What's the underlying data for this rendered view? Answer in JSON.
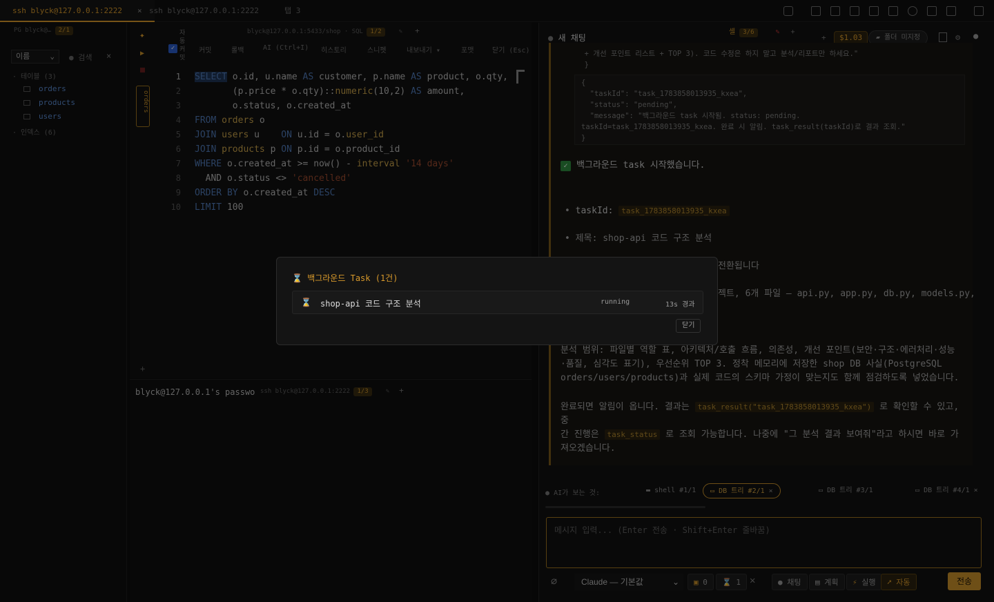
{
  "tabs": [
    {
      "label": "ssh blyck@127.0.0.1:2222",
      "close": "×"
    },
    {
      "label": "ssh blyck@127.0.0.1:2222"
    },
    {
      "label": "탭 3"
    }
  ],
  "left_panel": {
    "conn": "PG blyck@…",
    "conn_badge": "2/1",
    "sort_label": "이름",
    "search_label": "검색",
    "tables_group": "테이블 (3)",
    "tables": [
      "orders",
      "products",
      "users"
    ],
    "indexes_group": "인덱스 (6)"
  },
  "editor": {
    "header": "blyck@127.0.0.1:5433/shop · SQL",
    "header_badge": "1/2",
    "autocommit": "자동커밋",
    "side_tab": "orders",
    "buttons": [
      "커밋",
      "롤백",
      "AI (Ctrl+I)",
      "히스토리",
      "스니펫",
      "내보내기 ▾",
      "포맷",
      "닫기 (Esc)"
    ],
    "lines": [
      [
        [
          "kw",
          "SELECT"
        ],
        [
          "tx",
          " o.id, u.name "
        ],
        [
          "kw",
          "AS"
        ],
        [
          "tx",
          " customer, p.name "
        ],
        [
          "kw",
          "AS"
        ],
        [
          "tx",
          " product, o.qty,"
        ]
      ],
      [
        [
          "tx",
          "       (p.price * o.qty)::"
        ],
        [
          "fn",
          "numeric"
        ],
        [
          "tx",
          "(10,2) "
        ],
        [
          "kw",
          "AS"
        ],
        [
          "tx",
          " amount,"
        ]
      ],
      [
        [
          "tx",
          "       o.status, o.created_at"
        ]
      ],
      [
        [
          "kw",
          "FROM"
        ],
        [
          "fn",
          " orders"
        ],
        [
          "tx",
          " o"
        ]
      ],
      [
        [
          "kw",
          "JOIN"
        ],
        [
          "fn",
          " users"
        ],
        [
          "tx",
          " u    "
        ],
        [
          "kw",
          "ON"
        ],
        [
          "tx",
          " u.id = o."
        ],
        [
          "fn",
          "user_id"
        ]
      ],
      [
        [
          "kw",
          "JOIN"
        ],
        [
          "fn",
          " products"
        ],
        [
          "tx",
          " p "
        ],
        [
          "kw",
          "ON"
        ],
        [
          "tx",
          " p.id = o.product_id"
        ]
      ],
      [
        [
          "kw",
          "WHERE"
        ],
        [
          "tx",
          " o.created_at >= now() - "
        ],
        [
          "fn",
          "interval"
        ],
        [
          "str",
          " '14 days'"
        ]
      ],
      [
        [
          "tx",
          "  AND o.status <> "
        ],
        [
          "str",
          "'cancelled'"
        ]
      ],
      [
        [
          "kw",
          "ORDER BY"
        ],
        [
          "tx",
          " o.created_at "
        ],
        [
          "kw",
          "DESC"
        ]
      ],
      [
        [
          "kw",
          "LIMIT"
        ],
        [
          "tx",
          " 100"
        ]
      ]
    ]
  },
  "terminal": {
    "text": "blyck@127.0.0.1's passwo",
    "header": "ssh blyck@127.0.0.1:2222",
    "badge": "1/3"
  },
  "chat": {
    "title": "새 채팅",
    "tab_label": "셸",
    "tab_badge": "3/6",
    "cost": "$1.03",
    "folder_btn": "폴더 미지정",
    "pre1": "  + 개선 포인트 리스트 + TOP 3). 코드 수정은 하지 말고 분석/리포트만 하세요.\"\n  }",
    "pre2": "{\n  \"taskId\": \"task_1783858013935_kxea\",\n  \"status\": \"pending\",\n  \"message\": \"백그라운드 task 시작됨. status: pending.\ntaskId=task_1783858013935_kxea. 완료 시 알림. task_result(taskId)로 결과 조회.\"\n}",
    "started": "백그라운드 task 시작했습니다.",
    "bullet1_label": "taskId:",
    "bullet1_code": "task_1783858013935_kxea",
    "bullet2": "제목: shop-api 코드 구조 분석",
    "partial1": "전환됩니다",
    "partial2": "젝트, 6개 파일 — api.py, app.py, db.py, models.py,",
    "para1": "분석 범위: 파일별 역할 표, 아키텍처/호출 흐름, 의존성, 개선 포인트(보안·구조·에러처리·성능\n·품질, 심각도 표기), 우선순위 TOP 3. 정착 메모리에 저장한 shop DB 사실(PostgreSQL\norders/users/products)과 실제 코드의 스키마 가정이 맞는지도 함께 점검하도록 넣었습니다.",
    "para2a": "완료되면 알림이 옵니다. 결과는 ",
    "para2_code1": "task_result(\"task_1783858013935_kxea\")",
    "para2b": " 로 확인할 수 있고, 중",
    "para2c": "간 진행은 ",
    "para2_code2": "task_status",
    "para2d": " 로 조회 가능합니다. 나중에 \"그 분석 결과 보여줘\"라고 하시면 바로 가",
    "para2e": "져오겠습니다.",
    "context_label": "AI가 보는 것:",
    "context_pills": [
      "shell #1/1",
      "DB 트리 #2/1",
      "DB 트리 #3/1",
      "DB 트리 #4/1"
    ],
    "input_placeholder": "메시지 입력... (Enter 전송 · Shift+Enter 줄바꿈)",
    "model": "Claude — 기본값",
    "count1": "0",
    "count2": "1",
    "modes": [
      "채팅",
      "계획",
      "실행",
      "자동"
    ],
    "send": "전송"
  },
  "modal": {
    "title": "백그라운드 Task (1건)",
    "task_name": "shop-api 코드 구조 분석",
    "task_status": "running",
    "task_elapsed": "13s 경과",
    "close": "닫기"
  },
  "colors": {
    "accent": "#d99a2b",
    "keyword": "#4f79b6",
    "link": "#5a8ad0"
  }
}
